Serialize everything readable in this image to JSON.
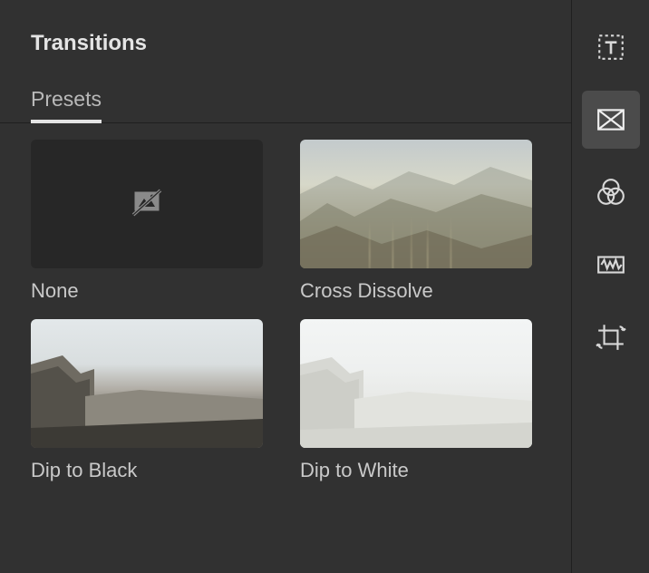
{
  "panel": {
    "title": "Transitions",
    "tabs": [
      {
        "label": "Presets",
        "active": true
      }
    ]
  },
  "presets": [
    {
      "id": "none",
      "label": "None",
      "icon": "no-transition-icon"
    },
    {
      "id": "cross-dissolve",
      "label": "Cross Dissolve",
      "icon": "cross-dissolve-thumbnail"
    },
    {
      "id": "dip-to-black",
      "label": "Dip to Black",
      "icon": "dip-to-black-thumbnail"
    },
    {
      "id": "dip-to-white",
      "label": "Dip to White",
      "icon": "dip-to-white-thumbnail"
    }
  ],
  "sidebar": {
    "tools": [
      {
        "id": "text",
        "icon": "text-frame-icon",
        "active": false
      },
      {
        "id": "transitions",
        "icon": "transitions-icon",
        "active": true
      },
      {
        "id": "color",
        "icon": "color-venn-icon",
        "active": false
      },
      {
        "id": "audio",
        "icon": "audio-wave-icon",
        "active": false
      },
      {
        "id": "crop",
        "icon": "crop-rotate-icon",
        "active": false
      }
    ]
  }
}
